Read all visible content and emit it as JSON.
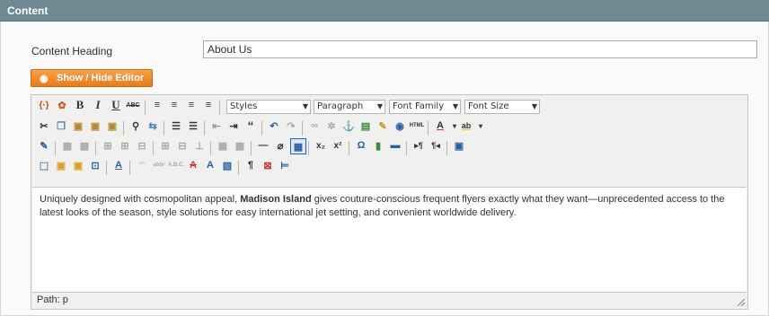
{
  "section": {
    "title": "Content"
  },
  "content_heading": {
    "label": "Content Heading",
    "value": "About Us"
  },
  "show_hide_button": {
    "label": "Show / Hide Editor"
  },
  "toolbar": {
    "styles": "Styles",
    "paragraph": "Paragraph",
    "font_family": "Font Family",
    "font_size": "Font Size",
    "bold": "B",
    "italic": "I",
    "underline": "U",
    "strikethrough": "ABC"
  },
  "editor": {
    "text_before_bold": "Uniquely designed with cosmopolitan appeal, ",
    "bold_text": "Madison Island",
    "text_after_bold": " gives couture-conscious frequent flyers exactly what they want—unprecedented access to the latest looks of the season, style solutions for easy international jet setting, and convenient worldwide delivery.",
    "path": "Path: p"
  },
  "colors": {
    "header": "#6f8992",
    "button": "#eb7d1c",
    "toolbar": "#f0f0ee"
  }
}
